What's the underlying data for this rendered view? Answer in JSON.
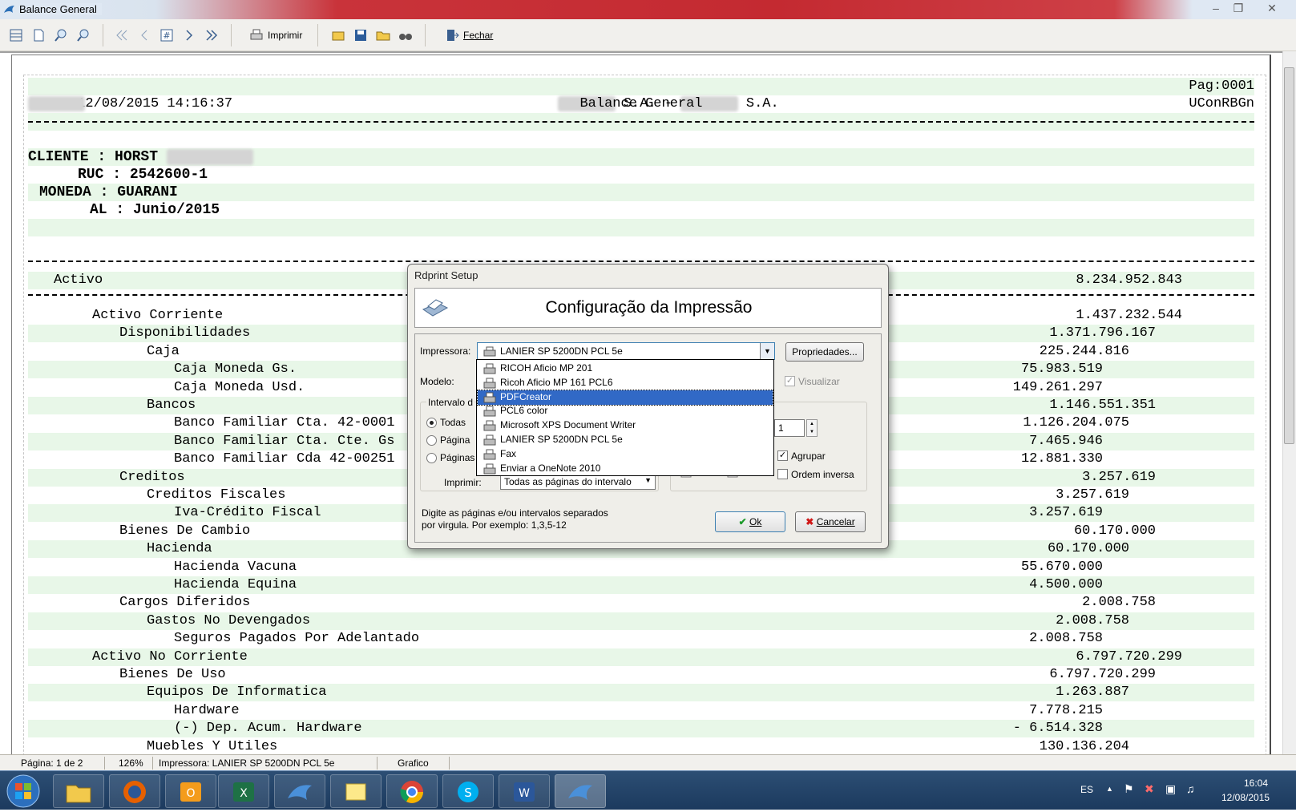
{
  "window": {
    "title": "Balance General"
  },
  "toolbar": {
    "print_label": "Imprimir",
    "close_label": "Fechar"
  },
  "report": {
    "datetime": "12/08/2015 14:16:37",
    "company_suffix_1": "S.A. -",
    "company_suffix_2": "S.A.",
    "page_label": "Pag:0001",
    "report_title": "Balance General",
    "report_code": "UConRBGn",
    "cliente_label": "CLIENTE :",
    "cliente_value": "HORST",
    "ruc_label": "RUC :",
    "ruc_value": "2542600-1",
    "moneda_label": "MONEDA :",
    "moneda_value": "GUARANI",
    "al_label": "AL :",
    "al_value": "Junio/2015",
    "rows": [
      {
        "label": "Activo",
        "value": "8.234.952.843"
      },
      {
        "label": "Activo Corriente",
        "value": "1.437.232.544"
      },
      {
        "label": "Disponibilidades",
        "value": "1.371.796.167"
      },
      {
        "label": "Caja",
        "value": "225.244.816"
      },
      {
        "label": "Caja Moneda Gs.",
        "value": "75.983.519"
      },
      {
        "label": "Caja Moneda Usd.",
        "value": "149.261.297"
      },
      {
        "label": "Bancos",
        "value": "1.146.551.351"
      },
      {
        "label": "Banco Familiar Cta. 42-0001",
        "value": "1.126.204.075"
      },
      {
        "label": "Banco Familiar Cta. Cte. Gs",
        "value": "7.465.946"
      },
      {
        "label": "Banco Familiar Cda 42-00251",
        "value": "12.881.330"
      },
      {
        "label": "Creditos",
        "value": "3.257.619"
      },
      {
        "label": "Creditos Fiscales",
        "value": "3.257.619"
      },
      {
        "label": "Iva-Crédito Fiscal",
        "value": "3.257.619"
      },
      {
        "label": "Bienes De Cambio",
        "value": "60.170.000"
      },
      {
        "label": "Hacienda",
        "value": "60.170.000"
      },
      {
        "label": "Hacienda Vacuna",
        "value": "55.670.000"
      },
      {
        "label": "Hacienda Equina",
        "value": "4.500.000"
      },
      {
        "label": "Cargos Diferidos",
        "value": "2.008.758"
      },
      {
        "label": "Gastos No Devengados",
        "value": "2.008.758"
      },
      {
        "label": "Seguros Pagados Por Adelantado",
        "value": "2.008.758"
      },
      {
        "label": "Activo No Corriente",
        "value": "6.797.720.299"
      },
      {
        "label": "Bienes De Uso",
        "value": "6.797.720.299"
      },
      {
        "label": "Equipos De Informatica",
        "value": "1.263.887"
      },
      {
        "label": "Hardware",
        "value": "7.778.215"
      },
      {
        "label": "(-) Dep. Acum. Hardware",
        "value": "- 6.514.328"
      },
      {
        "label": "Muebles Y Utiles",
        "value": "130.136.204"
      }
    ]
  },
  "dialog": {
    "title": "Rdprint Setup",
    "heading": "Configuração da Impressão",
    "printer_label": "Impressora:",
    "printer_value": "LANIER SP 5200DN PCL 5e",
    "properties_button": "Propriedades...",
    "model_label": "Modelo:",
    "visualizar_label": "Visualizar",
    "interval_label": "Intervalo d",
    "radio_all": "Todas",
    "radio_page": "Página",
    "radio_pages": "Páginas",
    "copies_value": "1",
    "agrupar_label": "Agrupar",
    "ordem_label": "Ordem inversa",
    "imprimir_label": "Imprimir:",
    "imprimir_value": "Todas as páginas do intervalo",
    "hint_line1": "Digite as páginas e/ou intervalos separados",
    "hint_line2": "por virgula.  Por exemplo: 1,3,5-12",
    "ok_button": "Ok",
    "cancel_button": "Cancelar",
    "printer_options": [
      "RICOH Aficio MP 201",
      "Ricoh Aficio MP 161 PCL6",
      "PDFCreator",
      "PCL6 color",
      "Microsoft XPS Document Writer",
      "LANIER SP 5200DN PCL 5e",
      "Fax",
      "Enviar a OneNote 2010"
    ],
    "selected_option": "PDFCreator"
  },
  "status": {
    "page": "Página: 1 de 2",
    "zoom": "126%",
    "printer": "Impressora: LANIER SP 5200DN PCL 5e",
    "mode": "Grafico"
  },
  "taskbar": {
    "language": "ES",
    "time": "16:04",
    "date": "12/08/2015"
  }
}
